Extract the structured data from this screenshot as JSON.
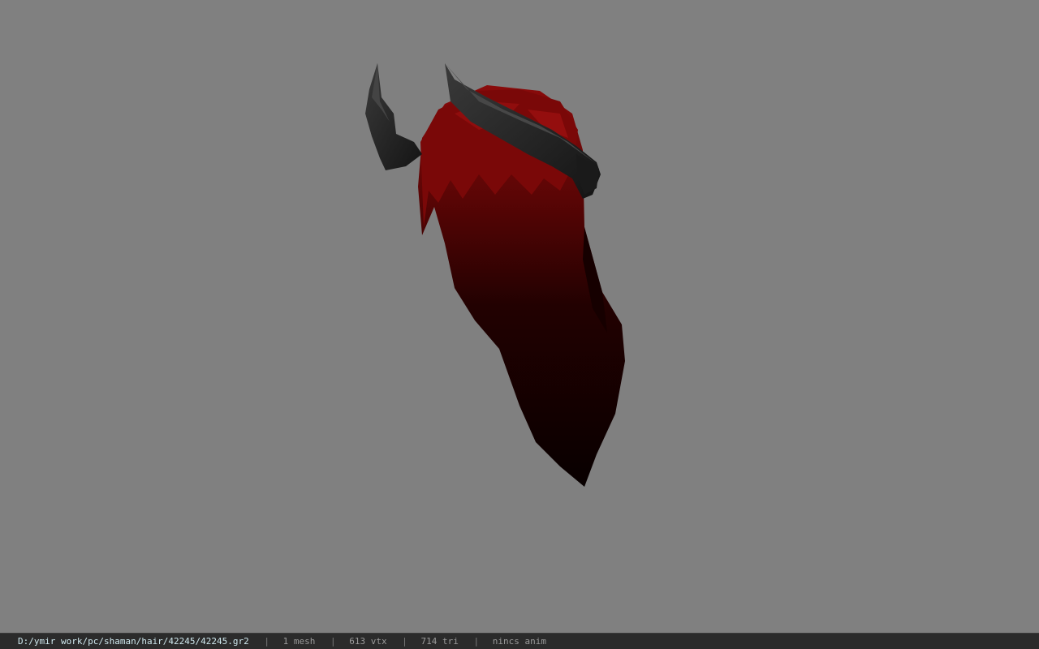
{
  "viewport": {
    "background_color": "#808080",
    "model_description_icon": "hair-model",
    "colors": {
      "hair_red": "#8a0b0b",
      "hair_dark": "#120000",
      "wing_dark": "#1c1c1c",
      "wing_highlight": "#3a3a3a"
    }
  },
  "statusbar": {
    "file_path": "D:/ymir work/pc/shaman/hair/42245/42245.gr2",
    "separator": "|",
    "mesh_count": "1 mesh",
    "vertex_count": "613 vtx",
    "triangle_count": "714 tri",
    "anim_status": "nincs anim"
  }
}
